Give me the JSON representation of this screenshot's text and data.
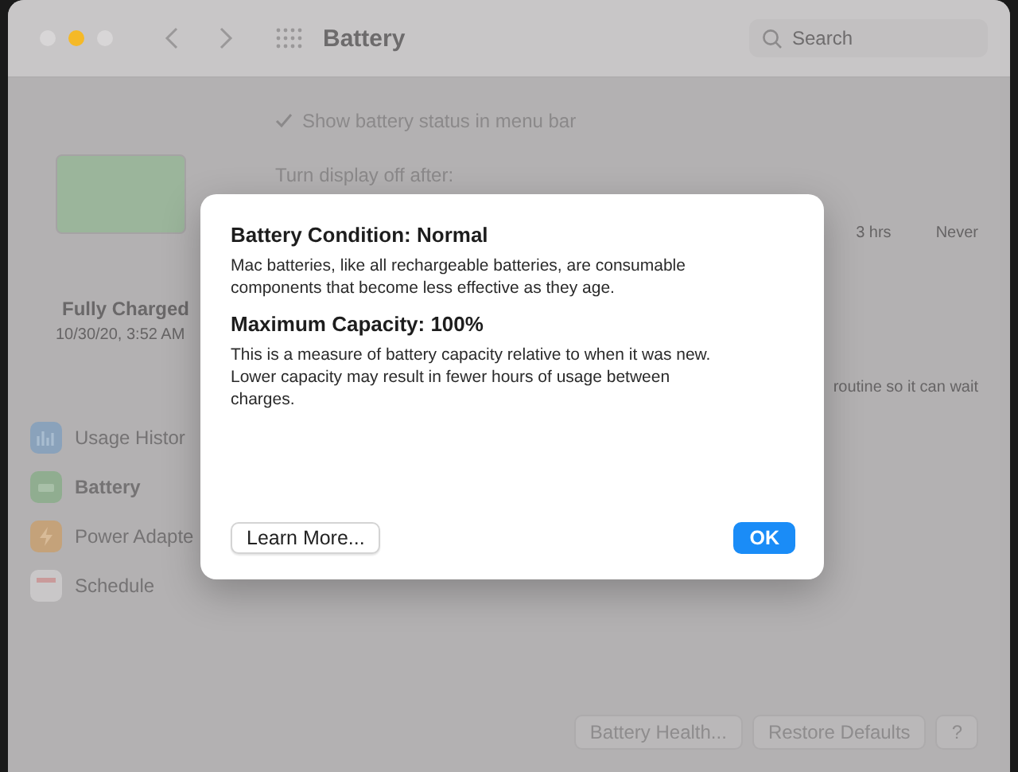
{
  "window": {
    "title": "Battery",
    "search": {
      "placeholder": "Search"
    }
  },
  "battery_summary": {
    "status": "Fully Charged",
    "date": "10/30/20, 3:52 AM"
  },
  "sidebar": {
    "items": [
      {
        "label": "Usage Histor",
        "kind": "chart",
        "selected": false
      },
      {
        "label": "Battery",
        "kind": "battery",
        "selected": true
      },
      {
        "label": "Power Adapte",
        "kind": "power",
        "selected": false
      },
      {
        "label": "Schedule",
        "kind": "calendar",
        "selected": false
      }
    ]
  },
  "settings": {
    "show_status": {
      "label": "Show battery status in menu bar",
      "checked": true
    },
    "display_off_label": "Turn display off after:",
    "slider_ticks": [
      "3 hrs",
      "Never"
    ],
    "note": "routine so it can wait"
  },
  "footer_buttons": [
    "Battery Health...",
    "Restore Defaults",
    "?"
  ],
  "dialog": {
    "sections": [
      {
        "heading": "Battery Condition: Normal",
        "body": "Mac batteries, like all rechargeable batteries, are consumable components that become less effective as they age."
      },
      {
        "heading": "Maximum Capacity: 100%",
        "body": "This is a measure of battery capacity relative to when it was new. Lower capacity may result in fewer hours of usage between charges."
      }
    ],
    "secondary_button": "Learn More...",
    "primary_button": "OK"
  }
}
